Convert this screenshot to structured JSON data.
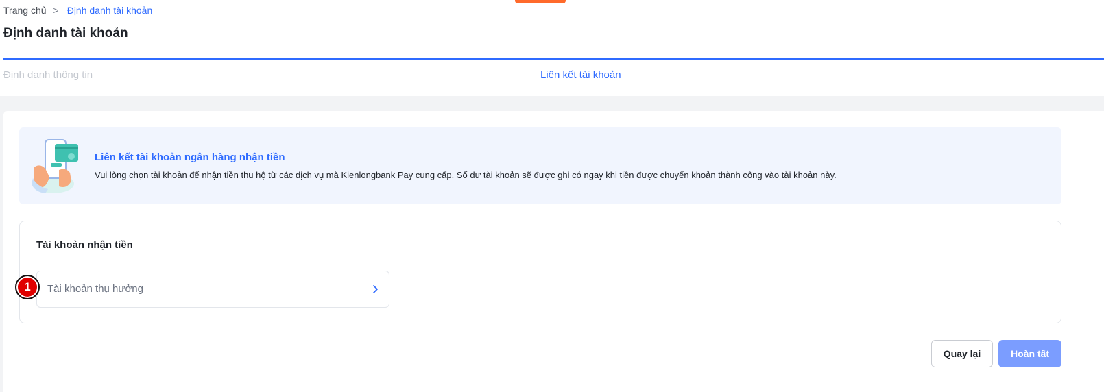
{
  "breadcrumb": {
    "home": "Trang chủ",
    "separator": ">",
    "current": "Định danh tài khoản"
  },
  "page": {
    "title": "Định danh tài khoản"
  },
  "steps": [
    {
      "label": "Định danh thông tin",
      "state": "done"
    },
    {
      "label": "Liên kết tài khoản",
      "state": "active"
    }
  ],
  "info": {
    "title": "Liên kết tài khoản ngân hàng nhận tiền",
    "description": "Vui lòng chọn tài khoản để nhận tiền thu hộ từ các dịch vụ mà Kienlongbank Pay cung cấp. Số dư tài khoản sẽ được ghi có ngay khi tiền được chuyển khoản thành công vào tài khoản này.",
    "illustration_icon": "phone-card-icon"
  },
  "receiving_account": {
    "section_title": "Tài khoản nhận tiền",
    "beneficiary_label": "Tài khoản thụ hưởng",
    "chevron_icon": "chevron-right-icon"
  },
  "annotation": {
    "marker": "1"
  },
  "actions": {
    "back_label": "Quay lại",
    "finish_label": "Hoàn tất"
  },
  "colors": {
    "primary": "#2f6bff",
    "primary_disabled": "#7b9dff",
    "info_bg": "#f1f5fe",
    "env_tag": "#ff6a2b",
    "marker": "#e00000"
  }
}
